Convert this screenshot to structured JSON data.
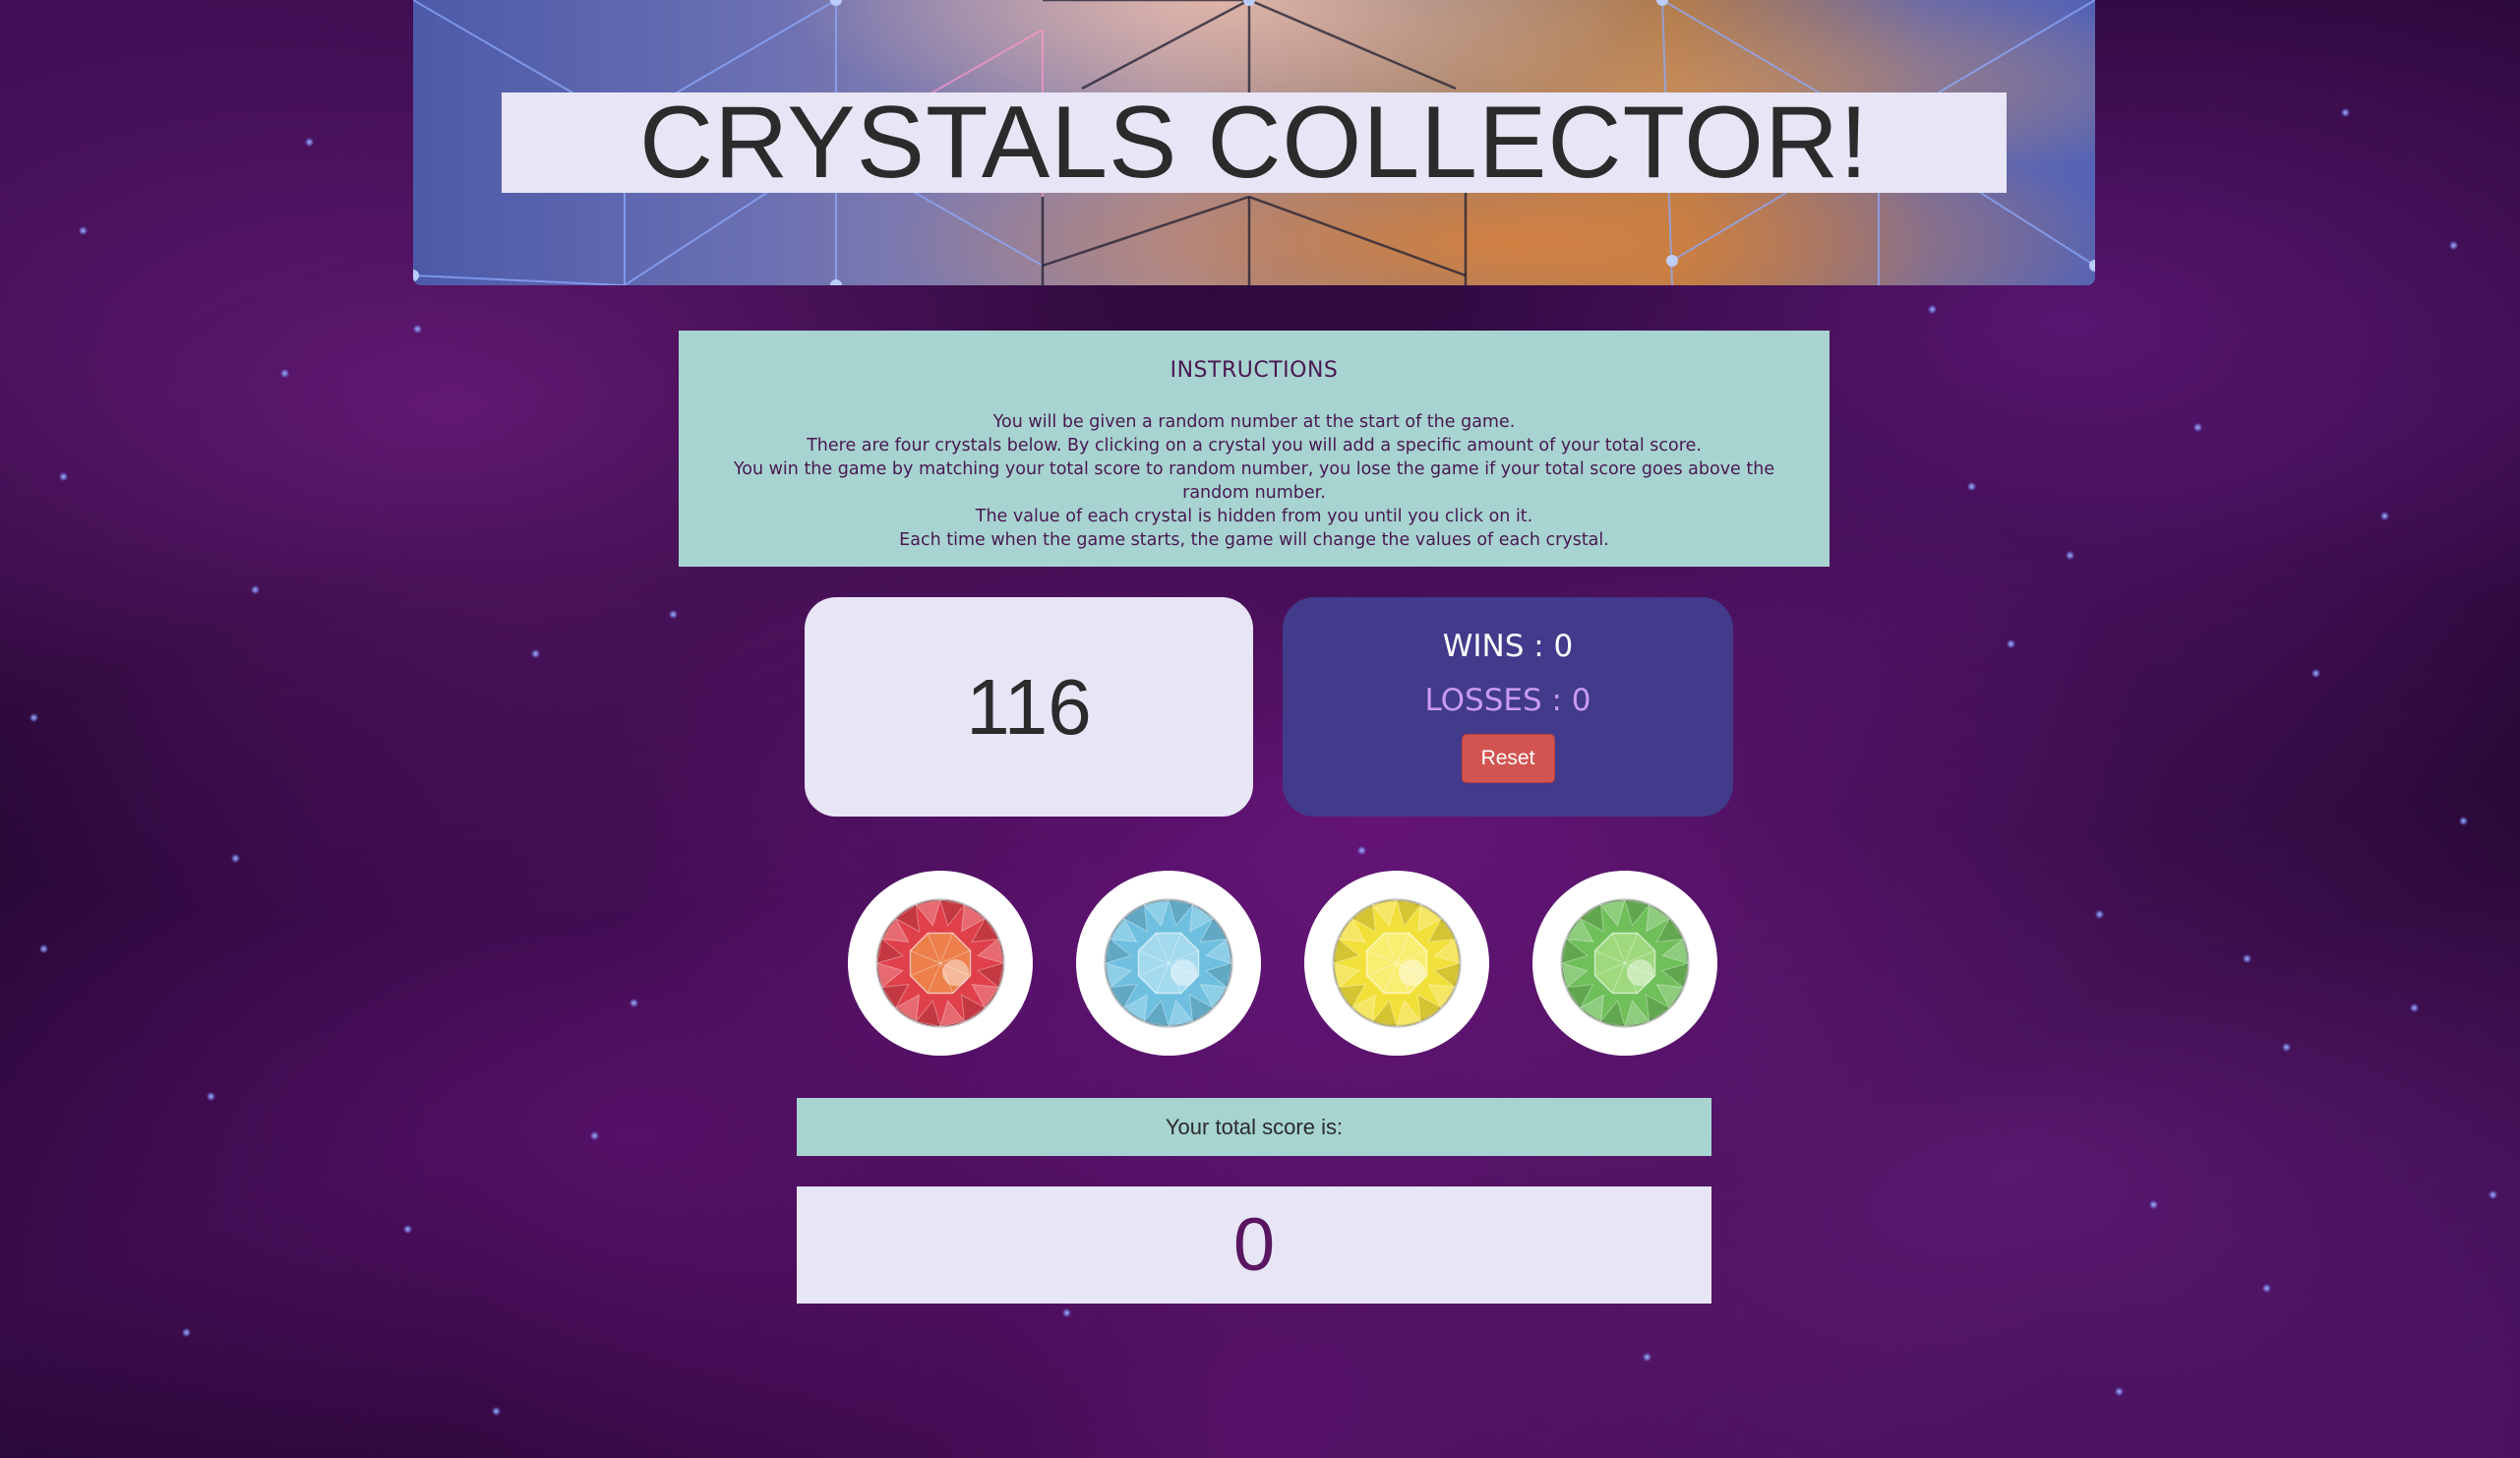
{
  "header": {
    "title": "CRYSTALS COLLECTOR!"
  },
  "instructions": {
    "heading": "INSTRUCTIONS",
    "lines": [
      "You will be given a random number at the start of the game.",
      "There are four crystals below. By clicking on a crystal you will add a specific amount of your total score.",
      "You win the game by matching your total score to random number, you lose the game if your total score goes above the random number.",
      "The value of each crystal is hidden from you until you click on it.",
      "Each time when the game starts, the game will change the values of each crystal."
    ]
  },
  "target": {
    "number": "116"
  },
  "stats": {
    "wins_text": "WINS : 0",
    "losses_text": "LOSSES : 0",
    "reset_label": "Reset"
  },
  "crystals": [
    {
      "name": "red-crystal-icon",
      "color": "#e0404a",
      "highlight": "#f6b24a"
    },
    {
      "name": "blue-crystal-icon",
      "color": "#6fc0e0",
      "highlight": "#cfeefa"
    },
    {
      "name": "yellow-crystal-icon",
      "color": "#f2e03a",
      "highlight": "#fff7a0"
    },
    {
      "name": "green-crystal-icon",
      "color": "#6fbf5a",
      "highlight": "#c7ee9c"
    }
  ],
  "score": {
    "label": "Your total score is:",
    "value": "0"
  },
  "colors": {
    "panel_light": "#e7e5f6",
    "panel_teal": "#a7d4d1",
    "panel_indigo": "#423a8a",
    "reset_red": "#d25450",
    "score_purple": "#5a1660"
  }
}
